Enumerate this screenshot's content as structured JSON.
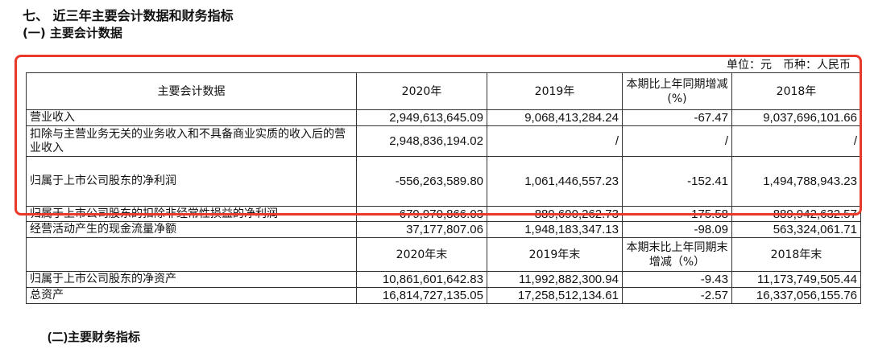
{
  "heading_section": "七、 近三年主要会计数据和财务指标",
  "heading_sub1": "(一) 主要会计数据",
  "unit_note": "单位：元　币种：人民币",
  "table": {
    "header1": [
      "主要会计数据",
      "2020年",
      "2019年",
      "本期比上年同期增减(%)",
      "2018年"
    ],
    "rows1": [
      [
        "营业收入",
        "2,949,613,645.09",
        "9,068,413,284.24",
        "-67.47",
        "9,037,696,101.66"
      ],
      [
        "扣除与主营业务无关的业务收入和不具备商业实质的收入后的营业收入",
        "2,948,836,194.02",
        "/",
        "/",
        "/"
      ],
      [
        "归属于上市公司股东的净利润",
        "-556,263,589.80",
        "1,061,446,557.23",
        "-152.41",
        "1,494,788,943.23"
      ],
      [
        "归属于上市公司股东的扣除非经常性损益的净利润",
        "-679,970,866.03",
        "889,690,262.73",
        "-175.58",
        "889,942,632.57"
      ],
      [
        "经营活动产生的现金流量净额",
        "37,177,807.06",
        "1,948,183,347.13",
        "-98.09",
        "563,324,061.71"
      ]
    ],
    "header2": [
      "",
      "2020年末",
      "2019年末",
      "本期末比上年同期末增减（%）",
      "2018年末"
    ],
    "rows2": [
      [
        "归属于上市公司股东的净资产",
        "10,861,601,642.83",
        "11,992,882,300.94",
        "-9.43",
        "11,173,749,505.44"
      ],
      [
        "总资产",
        "16,814,727,135.05",
        "17,258,512,134.61",
        "-2.57",
        "16,337,056,155.76"
      ]
    ]
  },
  "heading_sub2_num": "(二)",
  "heading_sub2_text": "主要财务指标",
  "colors": {
    "highlight_box": "#e8392a"
  }
}
